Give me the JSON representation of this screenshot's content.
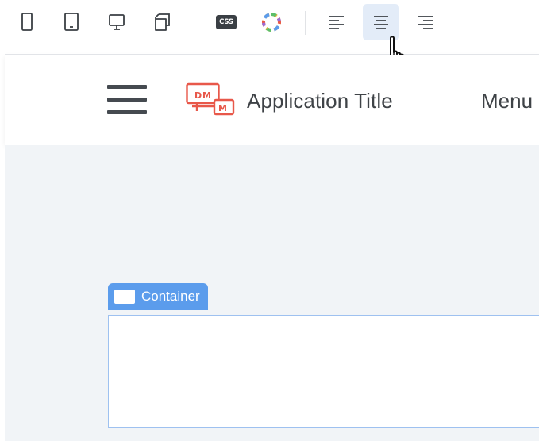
{
  "toolbar": {
    "device_buttons": [
      {
        "id": "mobile",
        "icon": "mobile-icon"
      },
      {
        "id": "tablet",
        "icon": "tablet-icon"
      },
      {
        "id": "desktop",
        "icon": "desktop-icon"
      },
      {
        "id": "responsive",
        "icon": "responsive-icon"
      }
    ],
    "css_button": {
      "label": "CSS",
      "icon": "css-icon"
    },
    "theme_button": {
      "icon": "color-palette-icon"
    },
    "align_buttons": [
      {
        "id": "left",
        "icon": "align-left-icon",
        "active": false
      },
      {
        "id": "center",
        "icon": "align-center-icon",
        "active": true
      },
      {
        "id": "right",
        "icon": "align-right-icon",
        "active": false
      }
    ]
  },
  "app_header": {
    "menu_icon": "hamburger-menu-icon",
    "logo_icon": "app-logo-icon",
    "title": "Application Title",
    "menu_label": "Menu"
  },
  "canvas": {
    "container_label": "Container",
    "container_icon": "container-icon"
  },
  "colors": {
    "toolbar_active_bg": "#e3ecf8",
    "canvas_bg": "#f1f4f7",
    "container_accent": "#5b9cec",
    "container_border": "#9ec1f0",
    "logo_accent": "#e8584a",
    "text_primary": "#3f4347"
  }
}
